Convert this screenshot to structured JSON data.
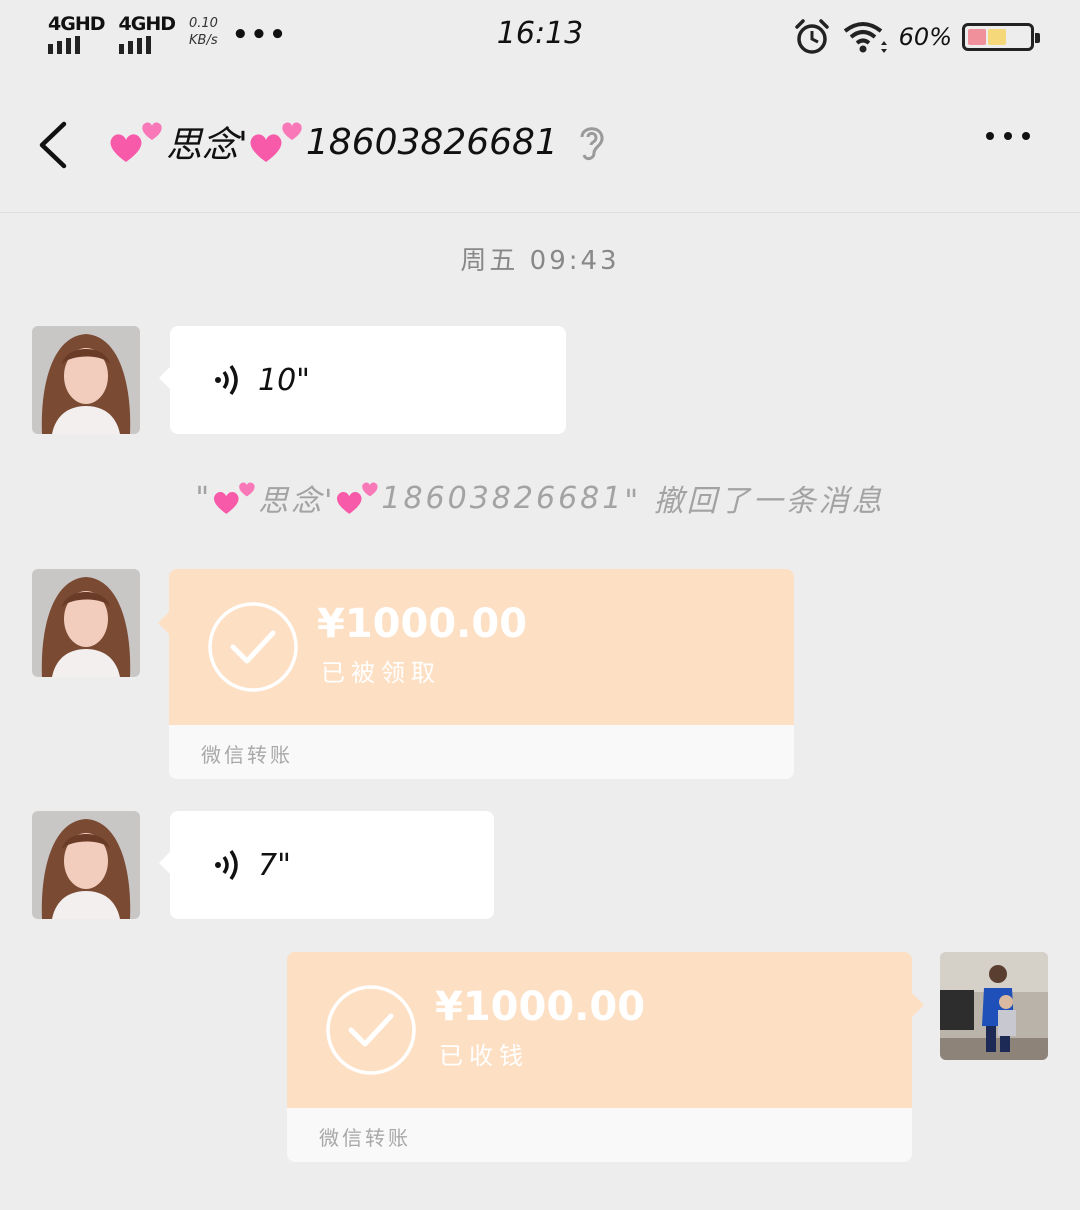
{
  "status_bar": {
    "network1": "4GHD",
    "network2": "4GHD",
    "speed_value": "0.10",
    "speed_unit": "KB/s",
    "overflow": "•••",
    "time": "16:13",
    "battery_text": "60%",
    "battery_level": 0.6
  },
  "header": {
    "title_part1": "思念'",
    "title_part2": "18603826681",
    "ear_icon": "ear-icon"
  },
  "messages": {
    "timestamp": "周五 09:43",
    "voice1": {
      "duration": "10\""
    },
    "recall": {
      "open_quote": "\"",
      "name_part1": "思念'",
      "name_part2": "18603826681",
      "suffix": "\" 撤回了一条消息"
    },
    "transfer1": {
      "amount": "¥1000.00",
      "status": "已被领取",
      "caption": "微信转账"
    },
    "voice2": {
      "duration": "7\""
    },
    "transfer2": {
      "amount": "¥1000.00",
      "status": "已收钱",
      "caption": "微信转账"
    }
  },
  "colors": {
    "transfer_bg": "#fddfc3",
    "chat_bg": "#ededed",
    "heart": "#f65aa8"
  }
}
